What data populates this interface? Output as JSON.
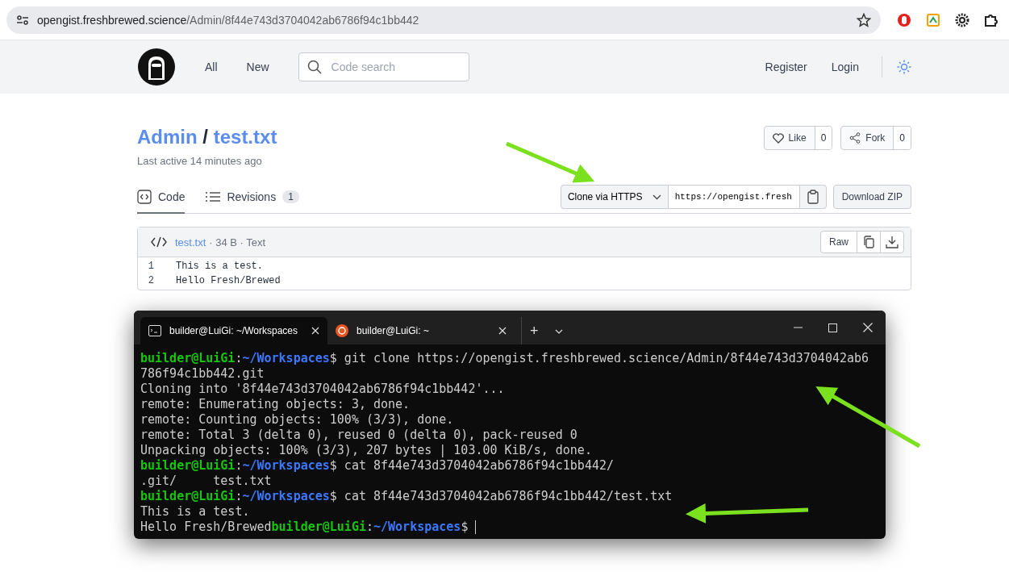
{
  "browser": {
    "url_host": "opengist.freshbrewed.science",
    "url_path": "/Admin/8f44e743d3704042ab6786f94c1bb442"
  },
  "nav": {
    "links": [
      "All",
      "New"
    ],
    "search": {
      "placeholder": "Code search"
    },
    "actions": [
      "Register",
      "Login"
    ]
  },
  "gist": {
    "owner": "Admin",
    "separator": "/",
    "title": "test.txt",
    "last_active": "Last active 14 minutes ago",
    "like": {
      "label": "Like",
      "count": "0"
    },
    "fork": {
      "label": "Fork",
      "count": "0"
    }
  },
  "tabs": [
    {
      "label": "Code",
      "selected": true
    },
    {
      "label": "Revisions",
      "count": "1",
      "selected": false
    }
  ],
  "clone": {
    "method": "Clone via HTTPS",
    "url": "https://opengist.fresh",
    "download": "Download ZIP"
  },
  "file": {
    "name": "test.txt",
    "meta": "· 34 B · Text",
    "raw": "Raw",
    "lines": [
      {
        "number": "1",
        "text": "This is a test."
      },
      {
        "number": "2",
        "text": "Hello Fresh/Brewed"
      }
    ]
  },
  "terminal": {
    "tabs": [
      {
        "title": "builder@LuiGi: ~/Workspaces",
        "selected": true
      },
      {
        "title": "builder@LuiGi: ~",
        "selected": false
      }
    ],
    "new_tab": "+",
    "lines": [
      [
        {
          "kind": "user",
          "text": "builder@LuiGi"
        },
        {
          "kind": "text",
          "text": ":"
        },
        {
          "kind": "path",
          "text": "~/Workspaces"
        },
        {
          "kind": "text",
          "text": "$ git clone https://opengist.freshbrewed.science/Admin/8f44e743d3704042ab6"
        }
      ],
      [
        {
          "kind": "text",
          "text": "786f94c1bb442.git"
        }
      ],
      [
        {
          "kind": "text",
          "text": "Cloning into '8f44e743d3704042ab6786f94c1bb442'..."
        }
      ],
      [
        {
          "kind": "text",
          "text": "remote: Enumerating objects: 3, done."
        }
      ],
      [
        {
          "kind": "text",
          "text": "remote: Counting objects: 100% (3/3), done."
        }
      ],
      [
        {
          "kind": "text",
          "text": "remote: Total 3 (delta 0), reused 0 (delta 0), pack-reused 0"
        }
      ],
      [
        {
          "kind": "text",
          "text": "Unpacking objects: 100% (3/3), 207 bytes | 103.00 KiB/s, done."
        }
      ],
      [
        {
          "kind": "user",
          "text": "builder@LuiGi"
        },
        {
          "kind": "text",
          "text": ":"
        },
        {
          "kind": "path",
          "text": "~/Workspaces"
        },
        {
          "kind": "text",
          "text": "$ cat 8f44e743d3704042ab6786f94c1bb442/"
        }
      ],
      [
        {
          "kind": "text",
          "text": ".git/     test.txt"
        }
      ],
      [
        {
          "kind": "user",
          "text": "builder@LuiGi"
        },
        {
          "kind": "text",
          "text": ":"
        },
        {
          "kind": "path",
          "text": "~/Workspaces"
        },
        {
          "kind": "text",
          "text": "$ cat 8f44e743d3704042ab6786f94c1bb442/test.txt"
        }
      ],
      [
        {
          "kind": "text",
          "text": "This is a test."
        }
      ],
      [
        {
          "kind": "text",
          "text": "Hello Fresh/Brewed"
        },
        {
          "kind": "user",
          "text": "builder@LuiGi"
        },
        {
          "kind": "text",
          "text": ":"
        },
        {
          "kind": "path",
          "text": "~/Workspaces"
        },
        {
          "kind": "text",
          "text": "$ "
        },
        {
          "kind": "cursor"
        }
      ]
    ]
  }
}
